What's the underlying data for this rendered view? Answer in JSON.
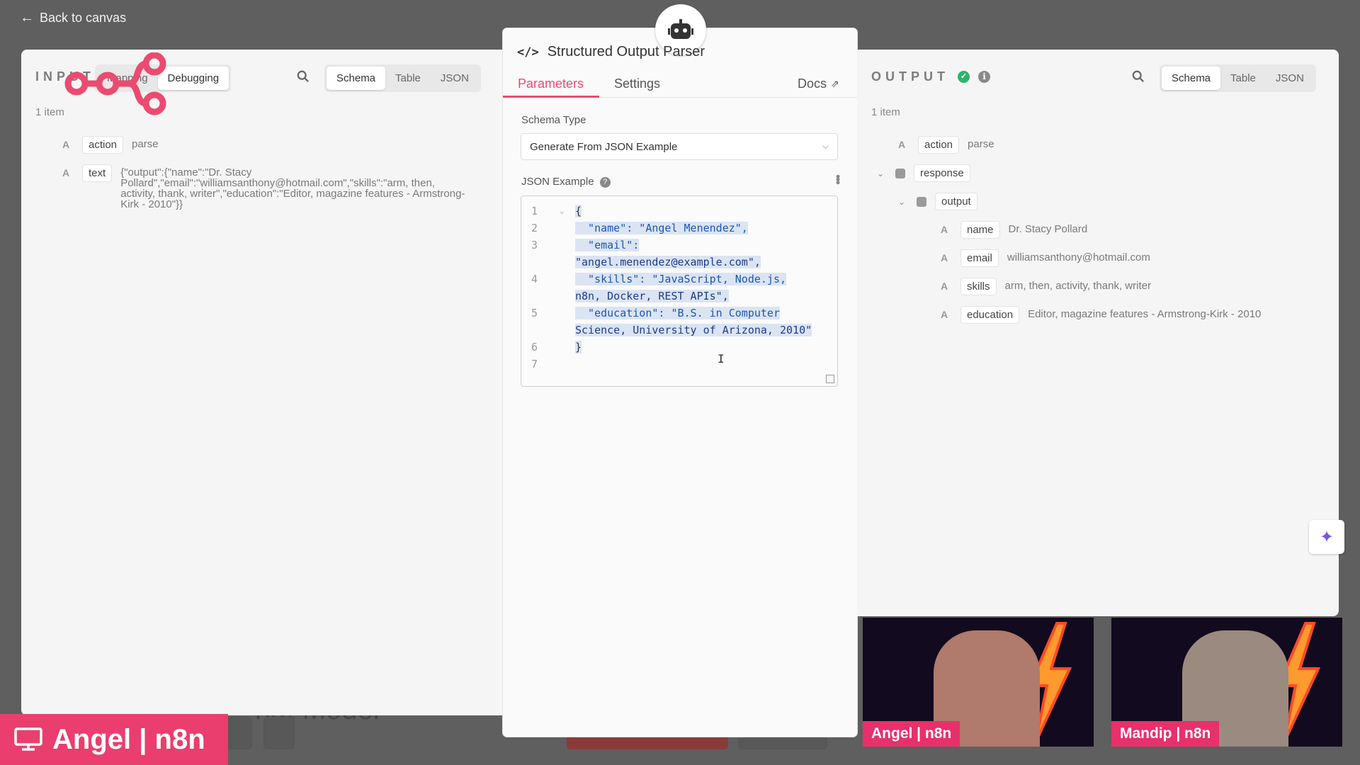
{
  "nav": {
    "back_label": "Back to canvas"
  },
  "input": {
    "label": "INPUT",
    "modes": [
      "Mapping",
      "Debugging"
    ],
    "views": [
      "Schema",
      "Table",
      "JSON"
    ],
    "item_count": "1 item",
    "fields": [
      {
        "type": "A",
        "key": "action",
        "value": "parse"
      },
      {
        "type": "A",
        "key": "text",
        "value_lines": [
          "{\"output\":{\"name\":\"Dr. Stacy",
          "Pollard\",\"email\":\"williamsanthony@hotmail.com\",\"skills\":\"arm, then,",
          "activity, thank, writer\",\"education\":\"Editor, magazine features - Armstrong-",
          "Kirk - 2010\"}}"
        ]
      }
    ]
  },
  "node": {
    "title": "Structured Output Parser",
    "tabs": [
      "Parameters",
      "Settings"
    ],
    "docs_label": "Docs",
    "schema_type_label": "Schema Type",
    "schema_type_value": "Generate From JSON Example",
    "json_example_label": "JSON Example",
    "help_glyph": "?",
    "editor_lines": [
      {
        "n": "1",
        "text": "{"
      },
      {
        "n": "2",
        "text": "  \"name\": \"Angel Menendez\","
      },
      {
        "n": "3",
        "text": "  \"email\":"
      },
      {
        "n": "",
        "text": "\"angel.menendez@example.com\","
      },
      {
        "n": "4",
        "text": "  \"skills\": \"JavaScript, Node.js,"
      },
      {
        "n": "",
        "text": "n8n, Docker, REST APIs\","
      },
      {
        "n": "5",
        "text": "  \"education\": \"B.S. in Computer"
      },
      {
        "n": "",
        "text": "Science, University of Arizona, 2010\""
      },
      {
        "n": "6",
        "text": "}"
      },
      {
        "n": "7",
        "text": ""
      }
    ]
  },
  "output": {
    "label": "OUTPUT",
    "views": [
      "Schema",
      "Table",
      "JSON"
    ],
    "item_count": "1 item",
    "fields": [
      {
        "type": "A",
        "key": "action",
        "value": "parse"
      },
      {
        "key": "response"
      },
      {
        "key": "output"
      },
      {
        "type": "A",
        "key": "name",
        "value": "Dr. Stacy Pollard"
      },
      {
        "type": "A",
        "key": "email",
        "value": "williamsanthony@hotmail.com"
      },
      {
        "type": "A",
        "key": "skills",
        "value": "arm, then, activity, thank, writer"
      },
      {
        "type": "A",
        "key": "education",
        "value": "Editor, magazine features - Armstrong-Kirk - 2010"
      }
    ]
  },
  "canvas": {
    "faded_title": "hat Model"
  },
  "webcams": [
    {
      "label": "Angel | n8n"
    },
    {
      "label": "Mandip | n8n"
    }
  ],
  "banner": {
    "label": "Angel | n8n"
  },
  "colors": {
    "accent": "#ea4b71",
    "banner": "#ea3e6e",
    "success": "#2fb36b"
  }
}
